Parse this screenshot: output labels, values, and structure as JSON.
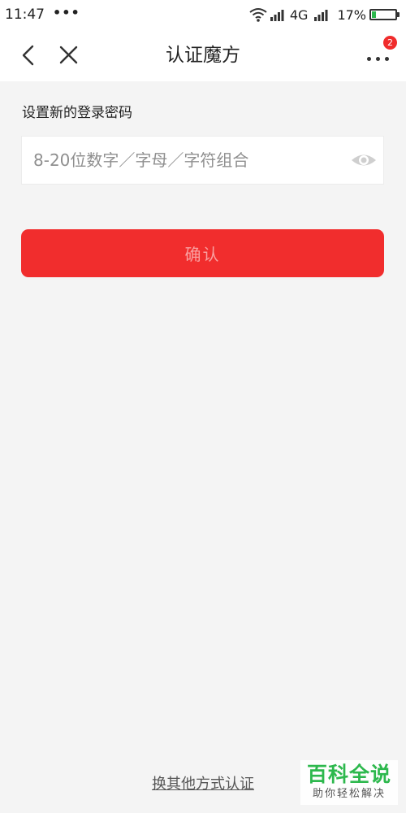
{
  "status_bar": {
    "time": "11:47",
    "more": "•••",
    "network": "4G",
    "battery": "17%",
    "battery_level": 0.17
  },
  "nav": {
    "title": "认证魔方",
    "badge_count": "2"
  },
  "form": {
    "label": "设置新的登录密码",
    "password_placeholder": "8-20位数字／字母／字符组合",
    "password_value": "",
    "confirm_label": "确认"
  },
  "footer": {
    "switch_method": "换其他方式认证"
  },
  "watermark": {
    "title": "百科全说",
    "subtitle": "助你轻松解决"
  },
  "colors": {
    "accent": "#f12d2d",
    "badge": "#f02c2c",
    "battery_fill": "#2db84d",
    "background": "#f4f4f4"
  },
  "icons": [
    "wifi-icon",
    "signal-icon",
    "battery-icon",
    "back-arrow-icon",
    "close-icon",
    "more-icon",
    "eye-icon"
  ]
}
